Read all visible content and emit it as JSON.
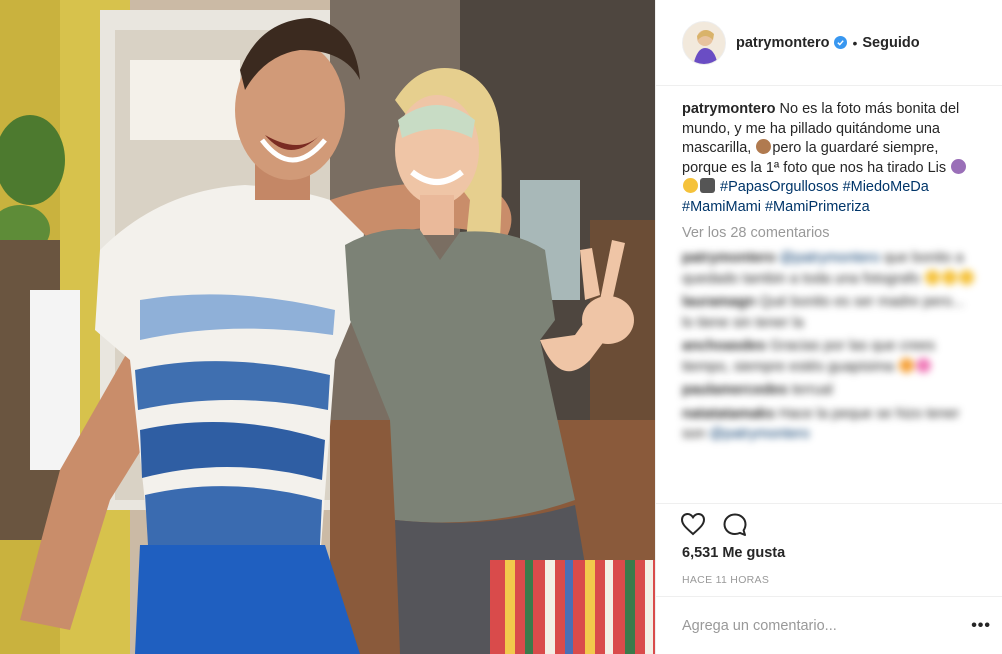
{
  "post": {
    "username": "patrymontero",
    "follow_separator": "•",
    "follow_status": "Seguido",
    "caption": {
      "user": "patrymontero",
      "text_1": "No es la foto más bonita del mundo, y me ha pillado quitándome una mascarilla, ",
      "text_2": "pero la guardaré siempre, porque es la 1ª foto que nos ha tirado Lis ",
      "hashtags": [
        "#PapasOrgullosos",
        "#MiedoMeDa",
        "#MamiMami",
        "#MamiPrimeriza"
      ]
    },
    "view_comments": "Ver los 28 comentarios",
    "comments": [
      {
        "user": "patrymontero",
        "mention": "@patrymontero",
        "text": "que bonito a quedado tambin a toda una fotografo"
      },
      {
        "user": "lauramagn",
        "text": "Qué bonito es ser madre pero... lo tiene sin tener la"
      },
      {
        "user": "anchoasdes",
        "text": "Gracias por las que crees tiempo, siempre estés guapisima"
      },
      {
        "user": "paulamercedes",
        "text": "terrual"
      },
      {
        "user": "natatatamaks",
        "text": "Hace la peque se hizo tener son",
        "mention": "@patrymontero"
      }
    ],
    "likes": "6,531 Me gusta",
    "time": "HACE 11 HORAS",
    "comment_placeholder": "Agrega un comentario...",
    "more_label": "•••"
  },
  "colors": {
    "text": "#262626",
    "muted": "#999999",
    "hashtag": "#003569",
    "verified": "#3897f0",
    "border": "#efefef"
  },
  "icons": [
    "heart-icon",
    "comment-icon",
    "verified-badge-icon",
    "more-options-icon"
  ]
}
